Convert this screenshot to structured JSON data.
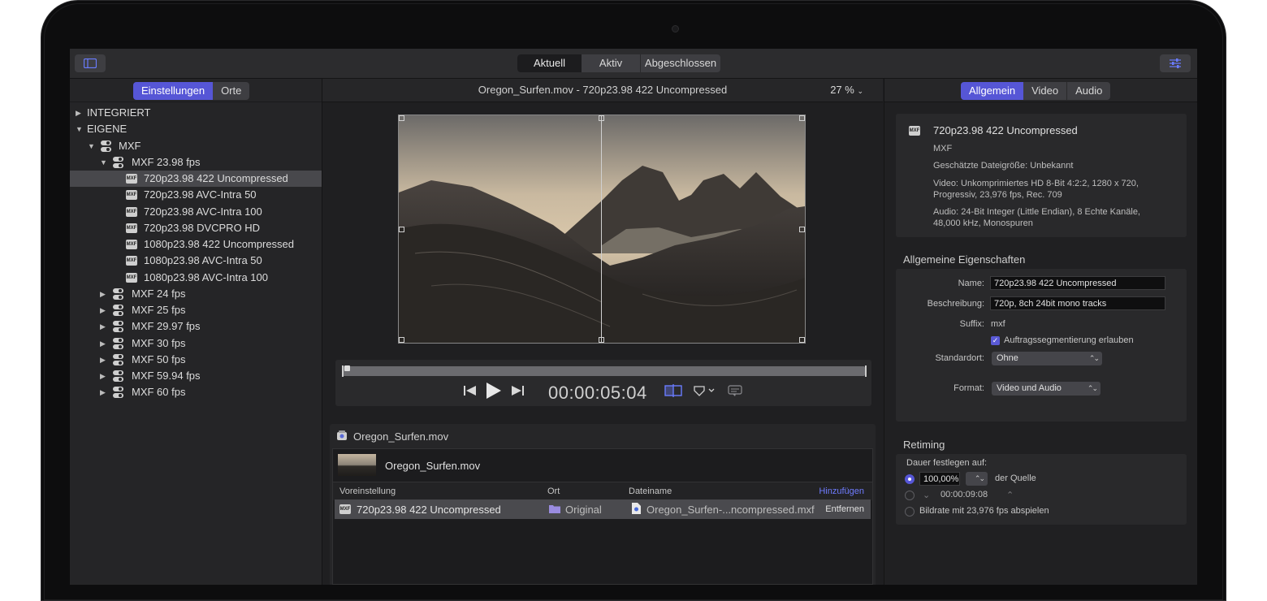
{
  "toolbar": {
    "tabs": [
      "Aktuell",
      "Aktiv",
      "Abgeschlossen"
    ],
    "selected_tab": "Aktuell"
  },
  "sidebar": {
    "tabs": [
      "Einstellungen",
      "Orte"
    ],
    "tree": [
      {
        "label": "INTEGRIERT",
        "level": 0,
        "type": "section",
        "expanded": false
      },
      {
        "label": "EIGENE",
        "level": 0,
        "type": "section",
        "expanded": true
      },
      {
        "label": "MXF",
        "level": 1,
        "type": "group",
        "expanded": true
      },
      {
        "label": "MXF 23.98 fps",
        "level": 2,
        "type": "group",
        "expanded": true
      },
      {
        "label": "720p23.98 422 Uncompressed",
        "level": 3,
        "type": "file",
        "selected": true
      },
      {
        "label": "720p23.98 AVC-Intra 50",
        "level": 3,
        "type": "file"
      },
      {
        "label": "720p23.98 AVC-Intra 100",
        "level": 3,
        "type": "file"
      },
      {
        "label": "720p23.98 DVCPRO HD",
        "level": 3,
        "type": "file"
      },
      {
        "label": "1080p23.98 422 Uncompressed",
        "level": 3,
        "type": "file"
      },
      {
        "label": "1080p23.98 AVC-Intra 50",
        "level": 3,
        "type": "file"
      },
      {
        "label": "1080p23.98 AVC-Intra 100",
        "level": 3,
        "type": "file"
      },
      {
        "label": "MXF 24 fps",
        "level": 2,
        "type": "group",
        "expanded": false
      },
      {
        "label": "MXF 25 fps",
        "level": 2,
        "type": "group",
        "expanded": false
      },
      {
        "label": "MXF 29.97 fps",
        "level": 2,
        "type": "group",
        "expanded": false
      },
      {
        "label": "MXF 30 fps",
        "level": 2,
        "type": "group",
        "expanded": false
      },
      {
        "label": "MXF 50 fps",
        "level": 2,
        "type": "group",
        "expanded": false
      },
      {
        "label": "MXF 59.94 fps",
        "level": 2,
        "type": "group",
        "expanded": false
      },
      {
        "label": "MXF 60 fps",
        "level": 2,
        "type": "group",
        "expanded": false
      }
    ]
  },
  "viewer": {
    "title": "Oregon_Surfen.mov - 720p23.98 422 Uncompressed",
    "zoom": "27 %",
    "timecode": "00:00:05:04"
  },
  "batch": {
    "title": "Oregon_Surfen.mov",
    "file_name": "Oregon_Surfen.mov",
    "columns": [
      "Voreinstellung",
      "Ort",
      "Dateiname"
    ],
    "add_label": "Hinzufügen",
    "row": {
      "preset": "720p23.98 422 Uncompressed",
      "location": "Original",
      "filename": "Oregon_Surfen-...ncompressed.mxf",
      "remove_label": "Entfernen"
    }
  },
  "inspector": {
    "tabs": [
      "Allgemein",
      "Video",
      "Audio"
    ],
    "summary": {
      "title": "720p23.98 422 Uncompressed",
      "format": "MXF",
      "size": "Geschätzte Dateigröße: Unbekannt",
      "video_line1": "Video: Unkomprimiertes HD 8-Bit 4:2:2, 1280 x 720,",
      "video_line2": "Progressiv, 23,976 fps, Rec. 709",
      "audio_line1": "Audio: 24-Bit Integer (Little Endian), 8 Echte Kanäle,",
      "audio_line2": "48,000 kHz, Monospuren"
    },
    "general": {
      "title": "Allgemeine Eigenschaften",
      "name_label": "Name:",
      "name_value": "720p23.98 422 Uncompressed",
      "desc_label": "Beschreibung:",
      "desc_value": "720p, 8ch 24bit mono tracks",
      "suffix_label": "Suffix:",
      "suffix_value": "mxf",
      "segment_label": "Auftragssegmentierung erlauben",
      "location_label": "Standardort:",
      "location_value": "Ohne",
      "format_label": "Format:",
      "format_value": "Video und Audio"
    },
    "retiming": {
      "title": "Retiming",
      "duration_label": "Dauer festlegen auf:",
      "percent_value": "100,00%",
      "of_source": "der Quelle",
      "time_value": "00:00:09:08",
      "framerate_label": "Bildrate mit 23,976 fps abspielen"
    }
  },
  "colors": {
    "accent": "#5656d6",
    "panel": "#252527",
    "background": "#1f1f21"
  }
}
